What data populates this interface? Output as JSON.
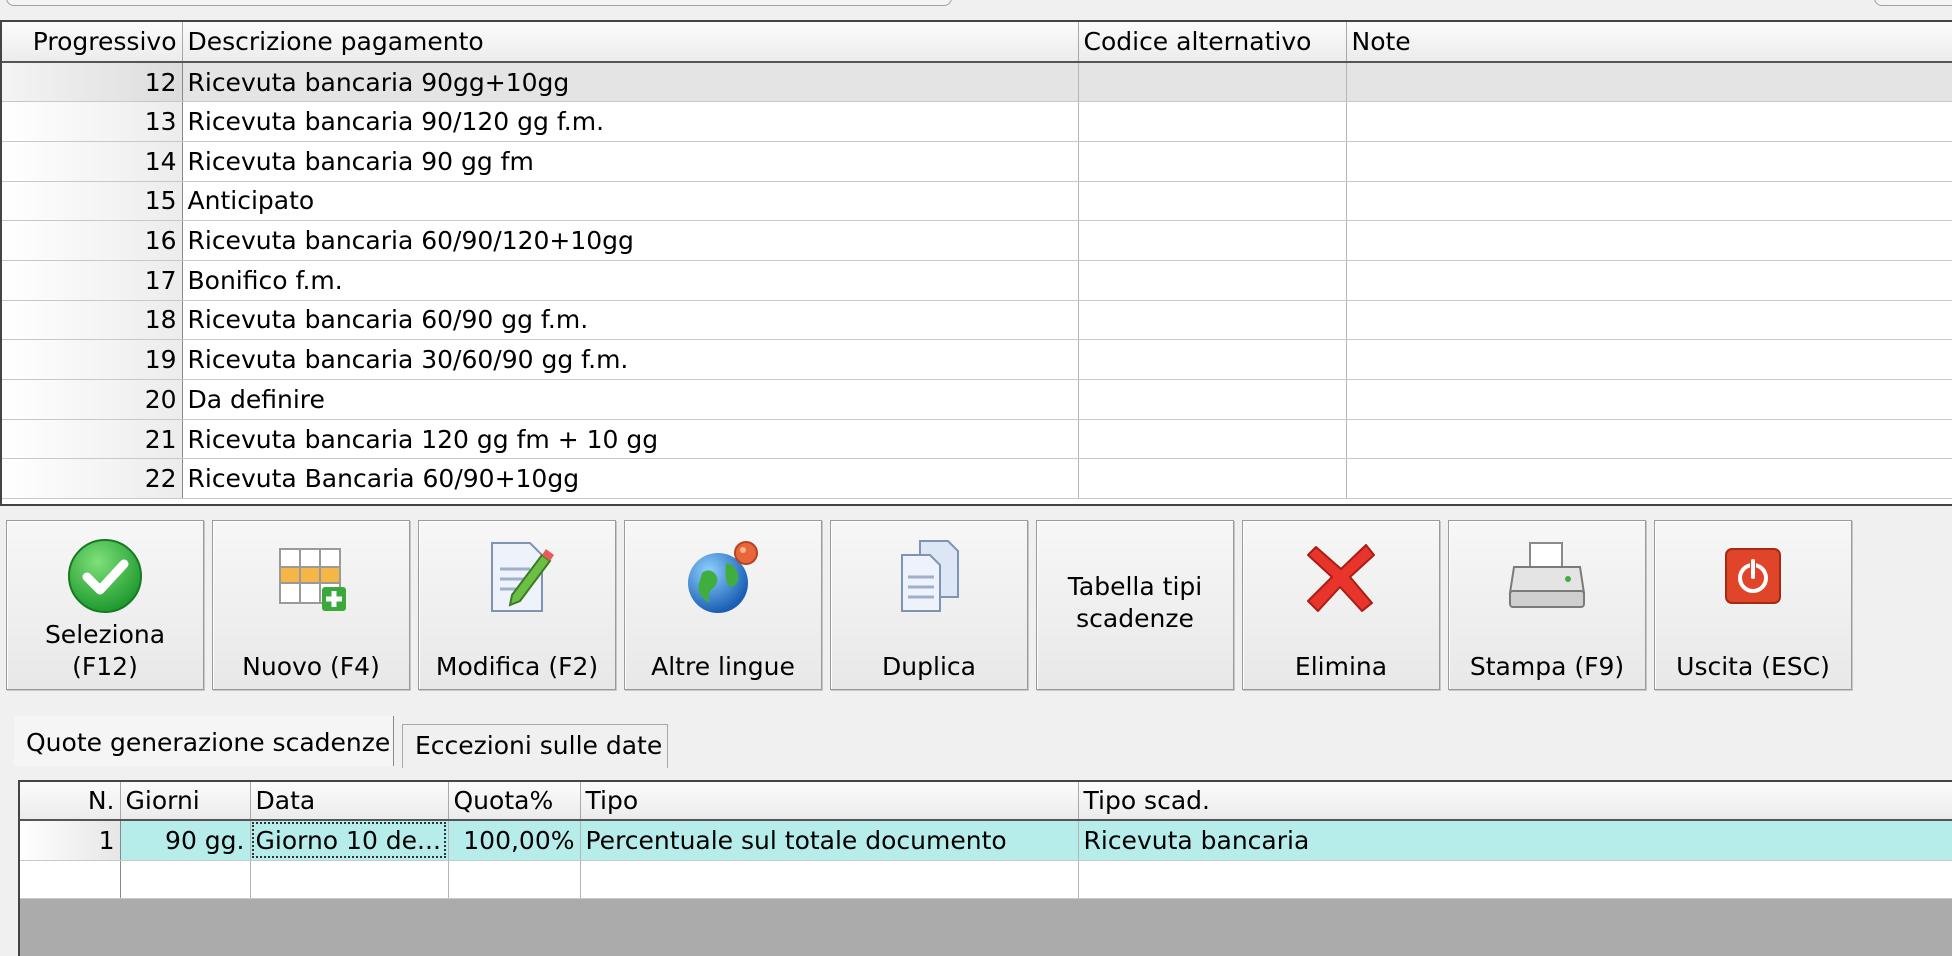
{
  "grid": {
    "columns": [
      "Progressivo",
      "Descrizione pagamento",
      "Codice alternativo",
      "Note"
    ],
    "rows": [
      {
        "prog": "12",
        "desc": "Ricevuta bancaria 90gg+10gg",
        "code": "",
        "note": ""
      },
      {
        "prog": "13",
        "desc": "Ricevuta bancaria 90/120 gg f.m.",
        "code": "",
        "note": ""
      },
      {
        "prog": "14",
        "desc": "Ricevuta bancaria 90 gg fm",
        "code": "",
        "note": ""
      },
      {
        "prog": "15",
        "desc": "Anticipato",
        "code": "",
        "note": ""
      },
      {
        "prog": "16",
        "desc": "Ricevuta bancaria 60/90/120+10gg",
        "code": "",
        "note": ""
      },
      {
        "prog": "17",
        "desc": "Bonifico f.m.",
        "code": "",
        "note": ""
      },
      {
        "prog": "18",
        "desc": "Ricevuta bancaria 60/90 gg f.m.",
        "code": "",
        "note": ""
      },
      {
        "prog": "19",
        "desc": "Ricevuta bancaria 30/60/90 gg f.m.",
        "code": "",
        "note": ""
      },
      {
        "prog": "20",
        "desc": "Da definire",
        "code": "",
        "note": ""
      },
      {
        "prog": "21",
        "desc": "Ricevuta bancaria 120 gg fm + 10 gg",
        "code": "",
        "note": ""
      },
      {
        "prog": "22",
        "desc": "Ricevuta Bancaria 60/90+10gg",
        "code": "",
        "note": ""
      }
    ]
  },
  "toolbar": {
    "seleziona": "Seleziona\n(F12)",
    "nuovo": "Nuovo (F4)",
    "modifica": "Modifica (F2)",
    "lingue": "Altre lingue",
    "duplica": "Duplica",
    "tabella": "Tabella tipi\nscadenze",
    "elimina": "Elimina",
    "stampa": "Stampa (F9)",
    "uscita": "Uscita (ESC)"
  },
  "tabs": [
    "Quote generazione scadenze",
    "Eccezioni sulle date"
  ],
  "grid2": {
    "columns": [
      "N.",
      "Giorni",
      "Data",
      "Quota%",
      "Tipo",
      "Tipo scad."
    ],
    "rows": [
      {
        "n": "1",
        "giorni": "90 gg.",
        "data": "Giorno 10 de...",
        "quota": "100,00%",
        "tipo": "Percentuale sul totale documento",
        "tiposcad": "Ricevuta bancaria"
      }
    ]
  },
  "colors": {
    "selected_row": "#e4e4e4",
    "highlight_row": "#b6ecea"
  }
}
